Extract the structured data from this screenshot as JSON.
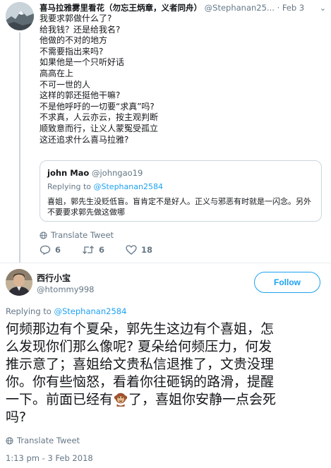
{
  "tweet1": {
    "author_name": "喜马拉雅雾里看花（勿忘王炳章，义者同舟）",
    "author_handle": "@Stephanan25...",
    "separator": "·",
    "date": "Feb 3",
    "lines": [
      "我要求郭做什么了?",
      "给我钱？还是给我名?",
      "他做的不对的地方",
      "不需要指出来吗?",
      "如果他是一个只听好话",
      "高高在上",
      "不可一世的人",
      "这样的郭还挺他干嘛?",
      "不是他呼吁的一切要“求真”吗?",
      "不求真，人云亦云，按主观判断",
      "顺致意而行，让义人蒙冤受孤立",
      "这还追求什么喜马拉雅?"
    ],
    "quote": {
      "author_name": "john Mao",
      "author_handle": "@johngao19",
      "replying_prefix": "Replying to",
      "replying_to": "@Stephanan2584",
      "text": "喜姐，郭先生没贬低盲。盲肯定不是好人。正义与邪恶有时就是一闪念。另外不要要求郭先做这做哪"
    },
    "translate_label": "Translate Tweet",
    "actions": {
      "replies": "6",
      "retweets": "6",
      "likes": "18"
    }
  },
  "tweet2": {
    "author_name": "西行小宝",
    "author_handle": "@htommy998",
    "follow_label": "Follow",
    "replying_prefix": "Replying to",
    "replying_to": "@Stephanan2584",
    "lines": [
      "何频那边有个夏朵，郭先生这边有个喜姐，怎",
      "么发现你们那么像呢? 夏朵给何频压力，何发",
      "推示意了；喜姐给文贵私信退推了，文贵没理",
      "你。你有些恼怒，看着你往砸锅的路滑，提醒",
      "一下。前面已经有",
      "了，喜姐你安静一点会死",
      "吗?"
    ],
    "emoji": "monkey-emoji",
    "translate_label": "Translate Tweet",
    "timestamp": "1:13 pm - 3 Feb 2018"
  },
  "colors": {
    "link": "#1da1f2",
    "secondary_text": "#657786",
    "primary_text": "#14171a",
    "border": "#ccd6dd"
  }
}
